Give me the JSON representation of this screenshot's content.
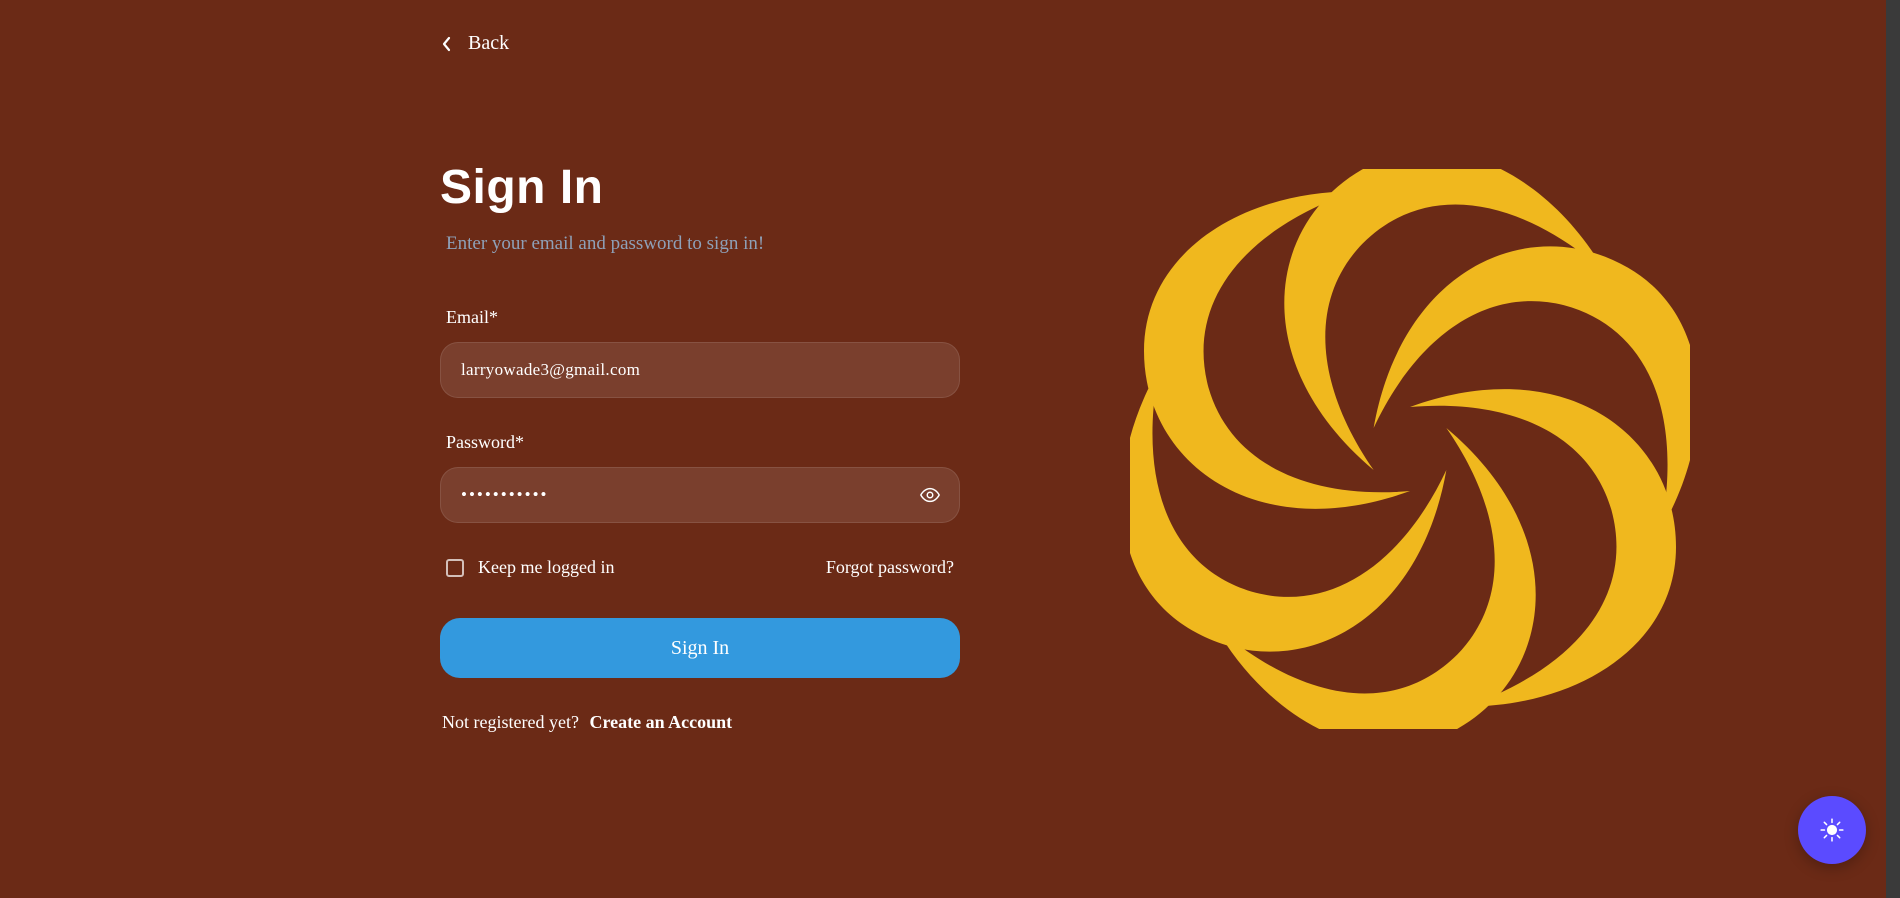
{
  "nav": {
    "back_label": "Back"
  },
  "page": {
    "title": "Sign In",
    "subtitle": "Enter your email and password to sign in!"
  },
  "form": {
    "email_label": "Email*",
    "email_value": "larryowade3@gmail.com",
    "email_placeholder": "",
    "password_label": "Password*",
    "password_value": "•••••••••••",
    "password_placeholder": "",
    "remember_label": "Keep me logged in",
    "forgot_label": "Forgot password?",
    "submit_label": "Sign In"
  },
  "footer": {
    "prompt": "Not registered yet?",
    "create_label": "Create an Account"
  },
  "icons": {
    "back": "chevron-left-icon",
    "eye": "eye-icon",
    "theme": "sun-icon",
    "swirl": "swirl-logo"
  },
  "colors": {
    "background": "#6b2a16",
    "accent_button": "#3399de",
    "fab": "#5b4bff",
    "swirl": "#f0b81e",
    "subtitle": "#8ea0b8"
  }
}
